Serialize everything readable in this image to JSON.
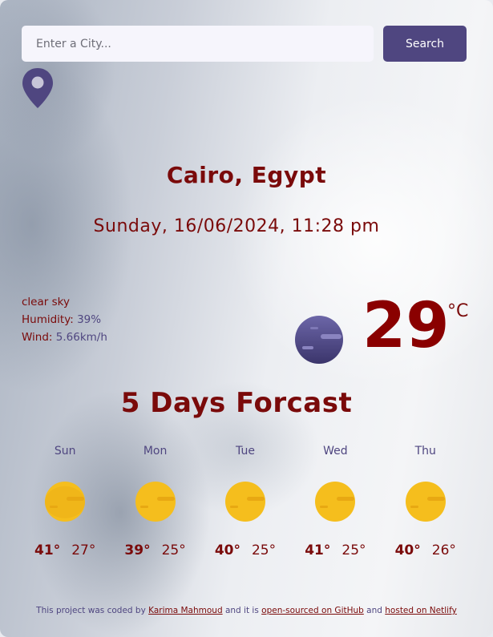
{
  "search": {
    "placeholder": "Enter a City...",
    "button_label": "Search"
  },
  "current": {
    "city": "Cairo, Egypt",
    "datetime": "Sunday, 16/06/2024, 11:28 pm",
    "description": "clear sky",
    "humidity_label": "Humidity:",
    "humidity_value": "39%",
    "wind_label": "Wind:",
    "wind_value": "5.66km/h",
    "temperature": "29",
    "unit": "°C",
    "icon": "clear-night-moon-icon"
  },
  "forecast": {
    "title": "5 Days Forcast",
    "days": [
      {
        "day": "Sun",
        "max": "41°",
        "min": "27°",
        "icon": "sun-icon"
      },
      {
        "day": "Mon",
        "max": "39°",
        "min": "25°",
        "icon": "sun-icon"
      },
      {
        "day": "Tue",
        "max": "40°",
        "min": "25°",
        "icon": "sun-icon"
      },
      {
        "day": "Wed",
        "max": "41°",
        "min": "25°",
        "icon": "sun-icon"
      },
      {
        "day": "Thu",
        "max": "40°",
        "min": "26°",
        "icon": "sun-icon"
      }
    ]
  },
  "footer": {
    "text1": "This project was coded by ",
    "author_link": "Karima Mahmoud",
    "text2": " and it is ",
    "github_link": "open-sourced on GitHub",
    "text3": " and ",
    "netlify_link": "hosted on Netlify"
  },
  "colors": {
    "accent": "#4f4680",
    "text": "#7a0a0a",
    "sun": "#f5be1d"
  }
}
